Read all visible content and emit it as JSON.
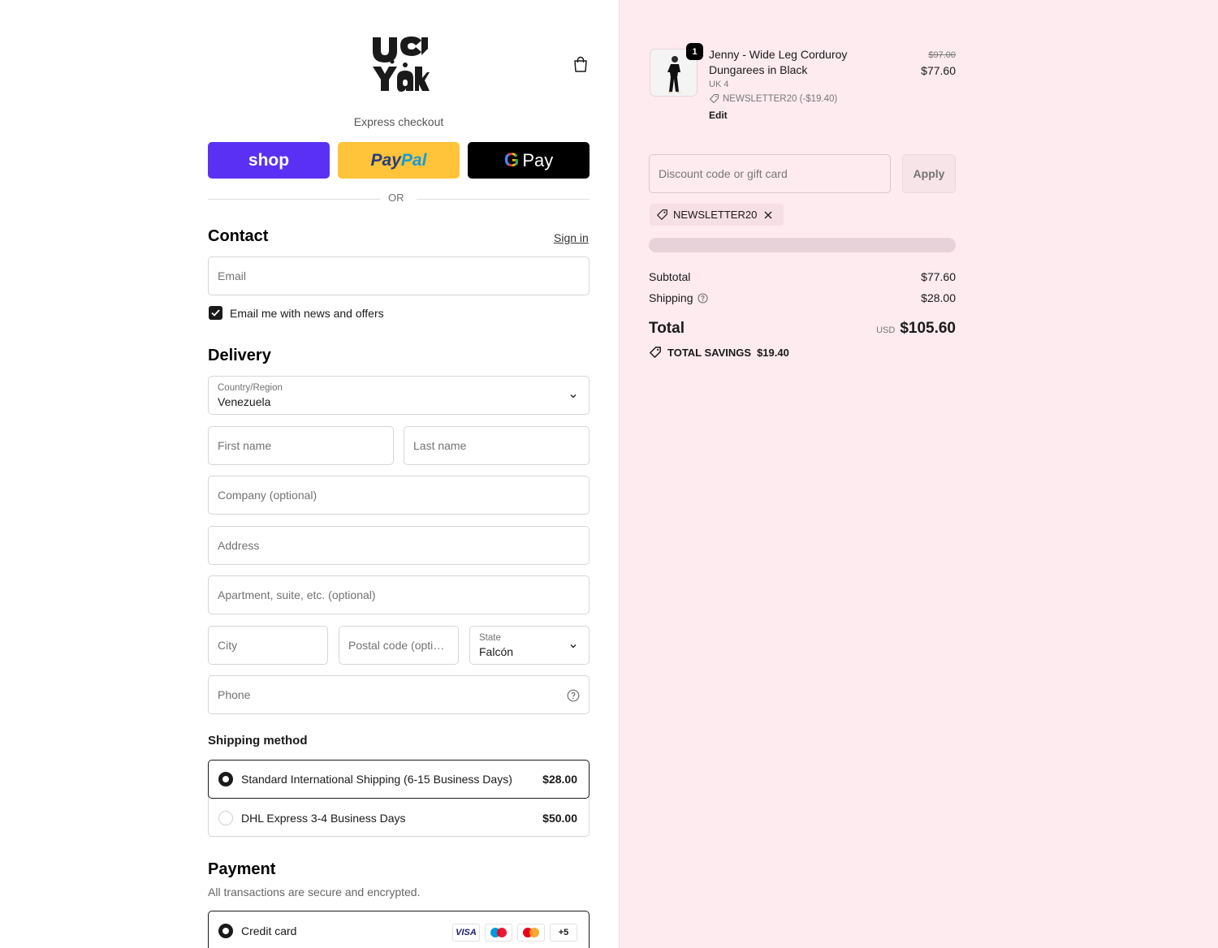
{
  "header": {
    "logo_text": "Lucy & Yak",
    "cart_icon": "bag-icon"
  },
  "express": {
    "label": "Express checkout",
    "shop_label": "shop",
    "paypal_label_1": "Pay",
    "paypal_label_2": "Pal",
    "gpay_g": "G",
    "gpay_label": "Pay",
    "or_label": "OR"
  },
  "contact": {
    "title": "Contact",
    "sign_in": "Sign in",
    "email_placeholder": "Email",
    "newsletter_label": "Email me with news and offers",
    "newsletter_checked": true
  },
  "delivery": {
    "title": "Delivery",
    "country_label": "Country/Region",
    "country_value": "Venezuela",
    "first_name_placeholder": "First name",
    "last_name_placeholder": "Last name",
    "company_placeholder": "Company (optional)",
    "address_placeholder": "Address",
    "apartment_placeholder": "Apartment, suite, etc. (optional)",
    "city_placeholder": "City",
    "postal_placeholder": "Postal code (opti…",
    "state_label": "State",
    "state_value": "Falcón",
    "phone_placeholder": "Phone"
  },
  "shipping": {
    "title": "Shipping method",
    "options": [
      {
        "name": "Standard International Shipping (6-15 Business Days)",
        "price": "$28.00",
        "selected": true
      },
      {
        "name": "DHL Express 3-4 Business Days",
        "price": "$50.00",
        "selected": false
      }
    ]
  },
  "payment": {
    "title": "Payment",
    "subtitle": "All transactions are secure and encrypted.",
    "method": "Credit card",
    "cards": [
      "VISA",
      "+5"
    ]
  },
  "summary": {
    "product": {
      "quantity": "1",
      "name": "Jenny - Wide Leg Corduroy Dungarees in Black",
      "variant": "UK 4",
      "discount": "NEWSLETTER20 (-$19.40)",
      "edit": "Edit",
      "old_price": "$97.00",
      "price": "$77.60"
    },
    "discount_placeholder": "Discount code or gift card",
    "apply": "Apply",
    "applied_code": "NEWSLETTER20",
    "subtotal_label": "Subtotal",
    "subtotal": "$77.60",
    "shipping_label": "Shipping",
    "shipping": "$28.00",
    "total_label": "Total",
    "currency": "USD",
    "total": "$105.60",
    "savings_label": "TOTAL SAVINGS",
    "savings": "$19.40"
  },
  "colors": {
    "shop": "#5a31f4",
    "paypal": "#ffc439",
    "gpay": "#000000",
    "summary_bg": "#fdebf0"
  }
}
